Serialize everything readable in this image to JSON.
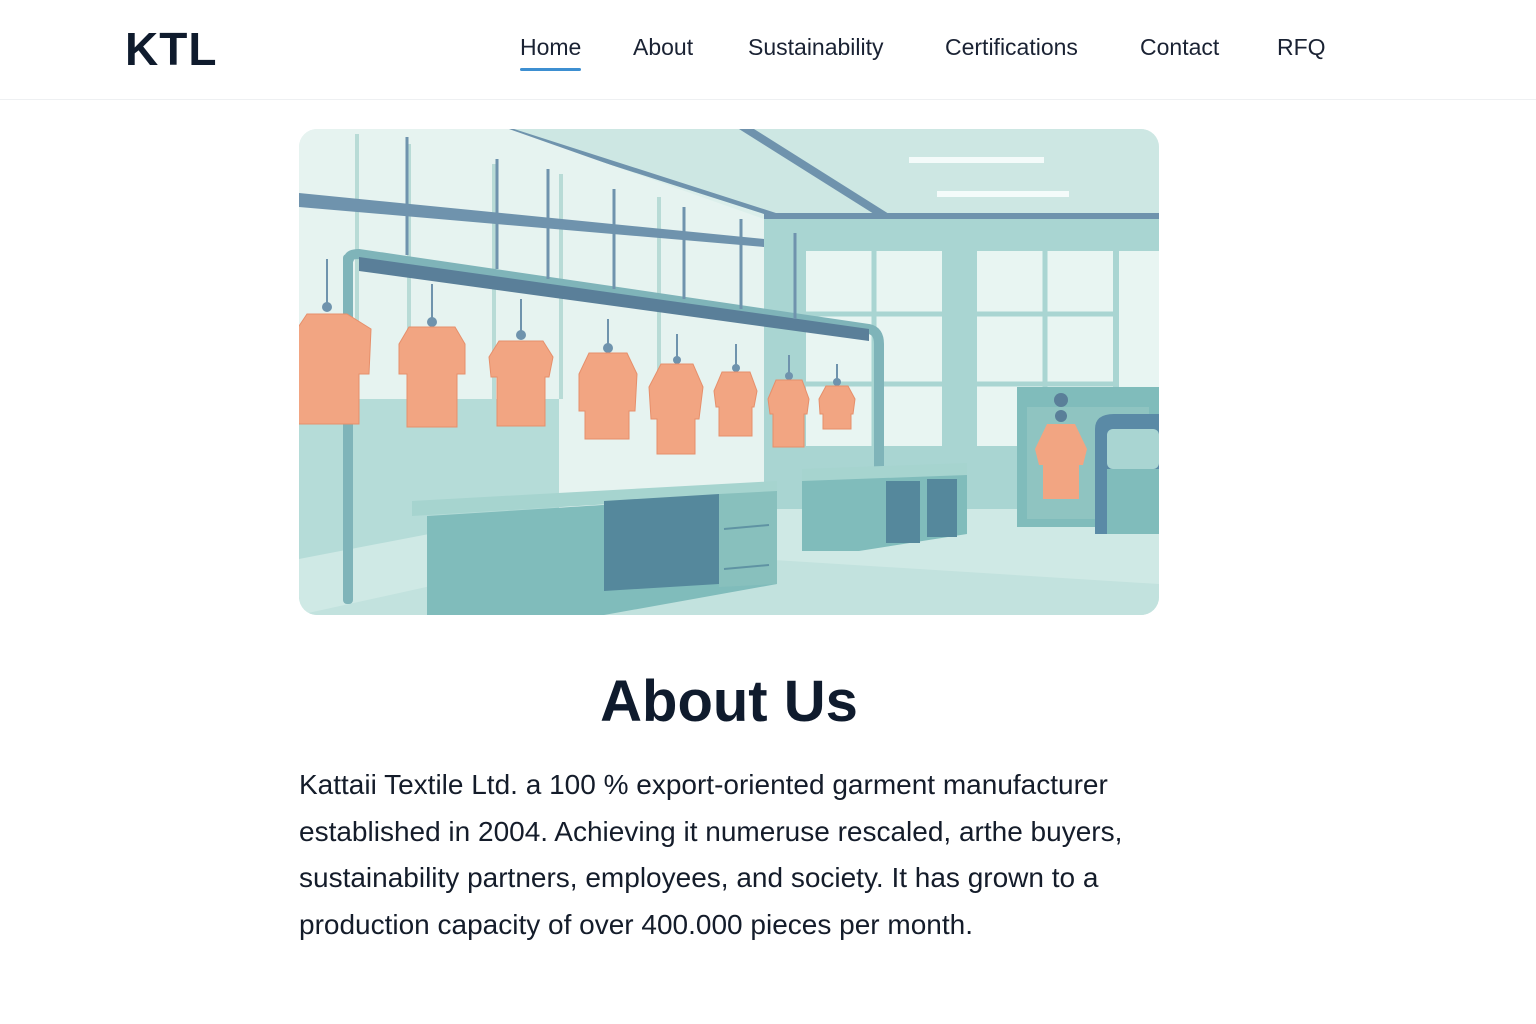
{
  "header": {
    "logo": "KTL",
    "nav": [
      {
        "label": "Home",
        "active": true
      },
      {
        "label": "About",
        "active": false
      },
      {
        "label": "Sustainability",
        "active": false
      },
      {
        "label": "Certifications",
        "active": false
      },
      {
        "label": "Contact",
        "active": false
      },
      {
        "label": "RFQ",
        "active": false
      }
    ],
    "accent_color": "#3d8fd1"
  },
  "hero": {
    "illustration": "garment-factory-illustration",
    "palette": {
      "mint": "#a9d5d2",
      "teal": "#7fbcbb",
      "steel": "#5a8aa6",
      "garment": "#f2a582"
    }
  },
  "about": {
    "title": "About Us",
    "lines": [
      "Kattaii Textile Ltd. a 100 % export-oriented garment manufacturer",
      "established in 2004. Achieving it numeruse rescaled, arthe buyers,",
      "sustainability partners, employees, and society. It has grown to a",
      "production capacity of over 400.000 pieces per month."
    ]
  }
}
